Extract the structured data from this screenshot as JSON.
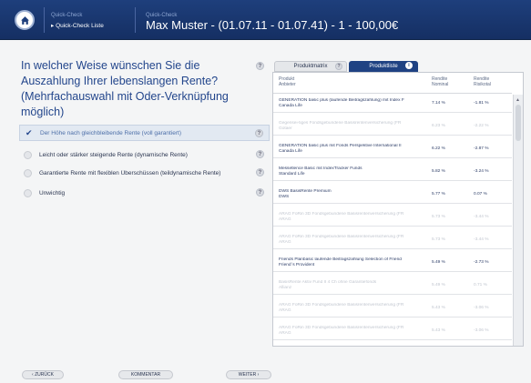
{
  "header": {
    "crumb1_top": "Quick-Check",
    "crumb1_sub": "▸ Quick-Check Liste",
    "crumb2_top": "Quick-Check",
    "title": "Max Muster - (01.07.11 - 01.07.41) - 1 - 100,00€"
  },
  "question": {
    "text": "In welcher Weise wünschen Sie die Auszahlung Ihrer lebenslangen Rente? (Mehrfachauswahl mit Oder-Verknüpfung möglich)",
    "help": "?"
  },
  "options": [
    {
      "label": "Der Höhe nach gleichbleibende Rente (voll garantiert)",
      "selected": true
    },
    {
      "label": "Leicht oder stärker steigende Rente (dynamische Rente)",
      "selected": false
    },
    {
      "label": "Garantierte Rente mit flexiblen Überschüssen (teildynamische Rente)",
      "selected": false
    },
    {
      "label": "Unwichtig",
      "selected": false
    }
  ],
  "tabs": {
    "matrix": "Produktmatrix",
    "list": "Produktliste",
    "help": "?",
    "info": "i"
  },
  "table": {
    "col_product_1": "Produkt",
    "col_product_2": "Anbieter",
    "col_nominal_1": "Rendite",
    "col_nominal_2": "Nominal",
    "col_risk_1": "Rendite",
    "col_risk_2": "Risikotal",
    "rows": [
      {
        "name1": "GENERATION basic plus (laufende Beitragszahlung) mit Index F",
        "name2": "Canada Life",
        "nom": "7.14 %",
        "risk": "-1.81 %",
        "dim": false
      },
      {
        "name1": "Gegensei-tiges Fondsgebundene Basisrentenversicherung (FR",
        "name2": "Gotaer",
        "nom": "6.23 %",
        "risk": "-2.22 %",
        "dim": true
      },
      {
        "name1": "GENERATION basic plus mit Fonds Perspektive International II",
        "name2": "Canada Life",
        "nom": "6.22 %",
        "risk": "-2.87 %",
        "dim": false
      },
      {
        "name1": "Messetlence Basic mit IndexTracker Funds",
        "name2": "Standard Life",
        "nom": "5.82 %",
        "risk": "-3.24 %",
        "dim": false
      },
      {
        "name1": "DWS BasisRente Premium",
        "name2": "DWS",
        "nom": "5.77 %",
        "risk": "0.07 %",
        "dim": false
      },
      {
        "name1": "ARAG FoRin 3D Fondsgebundene Basisrentenversicherung (FR",
        "name2": "ARAG",
        "nom": "5.73 %",
        "risk": "-3.44 %",
        "dim": true
      },
      {
        "name1": "ARAG FoRin 3D Fondsgebundene Basisrentenversicherung (FR",
        "name2": "ARAG",
        "nom": "5.73 %",
        "risk": "-3.44 %",
        "dim": true
      },
      {
        "name1": "Friends Planbasic laufende Beitragszahlung Selection of Friend",
        "name2": "Friend´s Provident",
        "nom": "5.49 %",
        "risk": "-2.73 %",
        "dim": false
      },
      {
        "name1": "BasisRente Aktiv Fund II 4 Ch ohne Garantiefonds",
        "name2": "Allianz",
        "nom": "5.49 %",
        "risk": "0.71 %",
        "dim": true
      },
      {
        "name1": "ARAG FoRin 3D Fondsgebundene Basisrentenversicherung (FR",
        "name2": "ARAG",
        "nom": "5.43 %",
        "risk": "-3.06 %",
        "dim": true
      },
      {
        "name1": "ARAG FoRin 3D Fondsgebundene Basisrentenversicherung (FR",
        "name2": "ARAG",
        "nom": "5.43 %",
        "risk": "-3.06 %",
        "dim": true
      }
    ]
  },
  "buttons": {
    "back": "‹ ZURÜCK",
    "comment": "KOMMENTAR",
    "next": "WEITER ›"
  },
  "colors": {
    "header_bg": "#1e3f7c",
    "accent": "#23468c",
    "selected_bg": "#e2e9f2"
  }
}
